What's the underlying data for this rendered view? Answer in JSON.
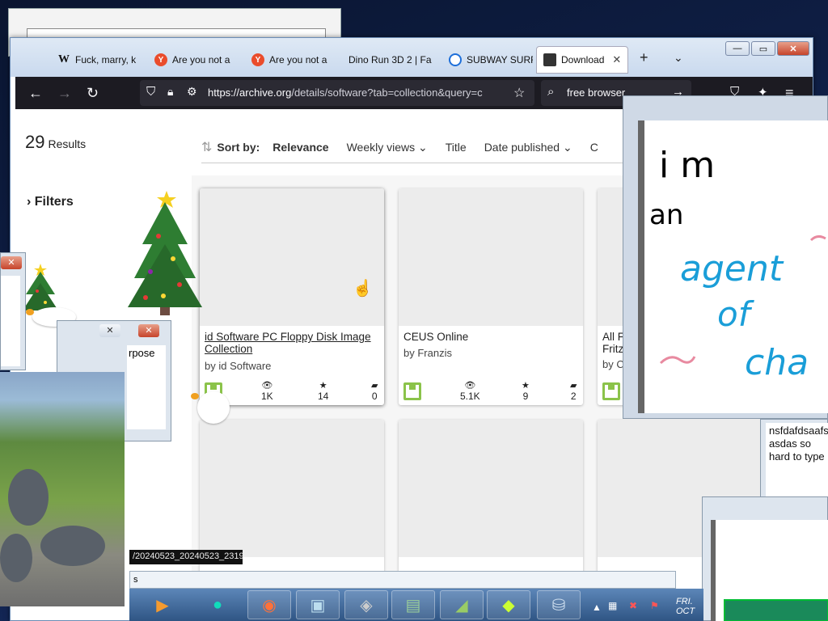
{
  "tabs": [
    {
      "label": "Fuck, marry, k",
      "favicon": "W",
      "color": "#ffffff"
    },
    {
      "label": "Are you not a",
      "favicon": "Y",
      "color": "#ea4c2c"
    },
    {
      "label": "Are you not a",
      "favicon": "Y",
      "color": "#ea4c2c"
    },
    {
      "label": "Dino Run 3D 2 | Fa",
      "favicon": "",
      "color": "#ffffff"
    },
    {
      "label": "SUBWAY SURF",
      "favicon": "",
      "color": "#1e6fd9"
    },
    {
      "label": "Download",
      "favicon": "",
      "color": "#333333"
    }
  ],
  "url": {
    "host": "https://archive.org",
    "path": "/details/software?tab=collection&query=c"
  },
  "search": {
    "query": "free browser"
  },
  "results": {
    "count": "29",
    "label": "Results"
  },
  "filters": {
    "label": "Filters"
  },
  "sort": {
    "label": "Sort by:",
    "options": [
      "Relevance",
      "Weekly views",
      "Title",
      "Date published",
      "C"
    ]
  },
  "cards": [
    {
      "title": "id Software PC Floppy Disk Image Collection",
      "by": "by id Software",
      "views": "1K",
      "favorites": "14",
      "reviews": "0"
    },
    {
      "title": "CEUS Online",
      "by": "by Franzis",
      "views": "5.1K",
      "favorites": "9",
      "reviews": "2"
    },
    {
      "title": "All F Fritz",
      "by": "by C",
      "views": "",
      "favorites": "",
      "reviews": ""
    }
  ],
  "note": {
    "handwriting": [
      "i m",
      "an",
      "agent",
      "of",
      "cha"
    ],
    "colors": {
      "ink": "#000000",
      "blue": "#1a9ed8",
      "pink": "#e88aa0"
    }
  },
  "text_window": {
    "content": "nsfdafdsaafs asdas so hard to type"
  },
  "small_window": {
    "text": "rpose"
  },
  "tooltip": {
    "text": "/20240523_20240523_2319"
  },
  "status_text": "s",
  "clock": {
    "day": "FRI.",
    "date": "OCT"
  },
  "taskbar_icons": [
    "media-player-icon",
    "app-icon",
    "firefox-icon",
    "control-panel-icon",
    "disk-tool-icon",
    "monitor-icon",
    "ruler-icon",
    "goose-icon",
    "drive-icon"
  ]
}
